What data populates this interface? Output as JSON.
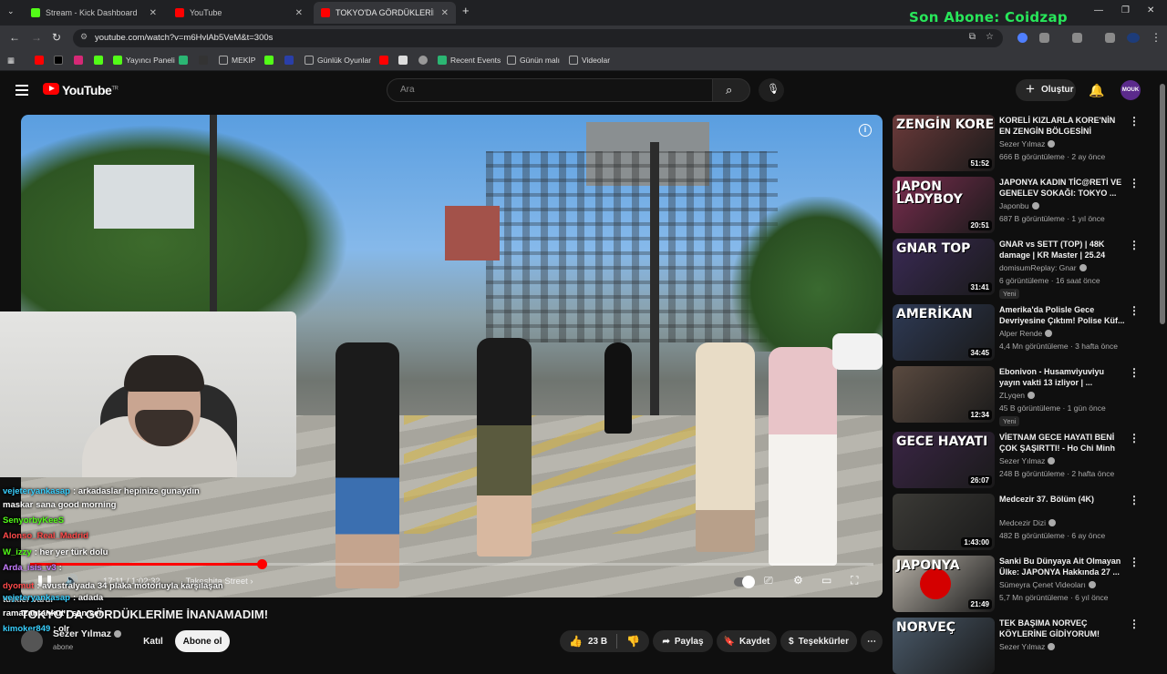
{
  "browser": {
    "tabs": [
      {
        "label": "Stream - Kick Dashboard",
        "color": "#53fc18"
      },
      {
        "label": "YouTube",
        "color": "#ff0000"
      },
      {
        "label": "TOKYO'DA GÖRDÜKLERİM...",
        "color": "#ff0000"
      }
    ],
    "new_tab": "+",
    "stream_overlay": "Son Abone: Coidzap",
    "url": "youtube.com/watch?v=m6HvlAb5VeM&t=300s",
    "bookmarks": [
      {
        "label": "Yayıncı Paneli",
        "color": "#53fc18"
      },
      {
        "label": "MEKİP",
        "color": "#888888"
      },
      {
        "label": "Günlük Oyunlar",
        "color": "#888888"
      },
      {
        "label": "Recent Events",
        "color": "#2bb673"
      },
      {
        "label": "Günün malı",
        "color": "#888888"
      },
      {
        "label": "Videolar",
        "color": "#888888"
      }
    ]
  },
  "header": {
    "brand": "YouTube",
    "brand_sup": "TR",
    "search_placeholder": "Ara",
    "create_label": "Oluştur",
    "avatar_text": "MOUK"
  },
  "player": {
    "time": "17:11 / 1:02:32",
    "chapter": "Takeshita Street",
    "progress": 0.275
  },
  "chat": [
    {
      "user": "vejeteryankasap",
      "msg": ": arkadaslar hepinize gunaydın",
      "color": "#39d0ff"
    },
    {
      "user": "maskar",
      "msg": "sana good morning",
      "color": "#ffffff"
    },
    {
      "user": "SenyorbyKeeS",
      "msg": "",
      "color": "#53fc18"
    },
    {
      "user": "Alonso_Real_Madrid",
      "msg": "",
      "color": "#ff4a4a"
    },
    {
      "user": "W_izzy",
      "msg": ": her yer türk dolu",
      "color": "#53fc18"
    },
    {
      "user": "Arda_isis_v3",
      "msg": ":",
      "color": "#c77dff"
    },
    {
      "user": "dyomut",
      "msg": ": avustralyada 34 plaka motorluyla karşılaşan türkler vardı",
      "color": "#ff4a4a"
    },
    {
      "user": "vejeteryankasap",
      "msg": ": adada",
      "color": "#39d0ff"
    },
    {
      "user": "ramazantankut",
      "msg": ": sen sen",
      "color": "#ffffff"
    },
    {
      "user": "kimoker849",
      "msg": ": olr",
      "color": "#39d0ff"
    }
  ],
  "video": {
    "title": "TOKYO'DA GÖRDÜKLERİME İNANAMADIM!",
    "channel": "Sezer Yılmaz",
    "subs": "abone",
    "join_label": "Katıl",
    "subscribe_label": "Abone ol",
    "likes": "23 B",
    "share_label": "Paylaş",
    "save_label": "Kaydet",
    "thanks_label": "Teşekkürler"
  },
  "recommendations": [
    {
      "thumb_text": "ZENGİN KORE",
      "thumb_color": "#6b3a3a",
      "duration": "51:52",
      "title": "KORELİ KIZLARLA KORE'NİN EN ZENGİN BÖLGESİNİ GEZDİM!",
      "channel": "Sezer Yılmaz",
      "meta": "666 B görüntüleme · 2 ay önce",
      "badge": ""
    },
    {
      "thumb_text": "JAPON LADYBOY",
      "thumb_color": "#7a2d4f",
      "duration": "20:51",
      "title": "JAPONYA KADIN TİC@RETİ VE GENELEV SOKAĞI: TOKYO ...",
      "channel": "Japonbu",
      "meta": "687 B görüntüleme · 1 yıl önce",
      "badge": ""
    },
    {
      "thumb_text": "GNAR TOP",
      "thumb_color": "#3a2a55",
      "duration": "31:41",
      "title": "GNAR vs SETT (TOP) | 48K damage | KR Master | 25.24",
      "channel": "domisumReplay: Gnar",
      "meta": "6 görüntüleme · 16 saat önce",
      "badge": "Yeni"
    },
    {
      "thumb_text": "AMERİKAN",
      "thumb_color": "#2e3a55",
      "duration": "34:45",
      "title": "Amerika'da Polisle Gece Devriyesine Çıktım! Polise Küf...",
      "channel": "Alper Rende",
      "meta": "4,4 Mn görüntüleme · 3 hafta önce",
      "badge": ""
    },
    {
      "thumb_text": "",
      "thumb_color": "#5a4a40",
      "duration": "12:34",
      "title": "Ebonivon - Husamviyuviyu yayın vakti 13 izliyor | ...",
      "channel": "ZLyqen",
      "meta": "45 B görüntüleme · 1 gün önce",
      "badge": "Yeni"
    },
    {
      "thumb_text": "GECE HAYATI",
      "thumb_color": "#3a2545",
      "duration": "26:07",
      "title": "VİETNAM GECE HAYATI BENİ ÇOK ŞAŞIRTTI! - Ho Chi Minh",
      "channel": "Sezer Yılmaz",
      "meta": "248 B görüntüleme · 2 hafta önce",
      "badge": ""
    },
    {
      "thumb_text": "",
      "thumb_color": "#3b3a36",
      "duration": "1:43:00",
      "title": "Medcezir 37. Bölüm (4K)",
      "channel": "Medcezir Dizi",
      "meta": "482 B görüntüleme · 6 ay önce",
      "badge": ""
    },
    {
      "thumb_text": "JAPONYA",
      "thumb_color": "#b8b2a8",
      "duration": "21:49",
      "title": "Sanki Bu Dünyaya Ait Olmayan Ülke: JAPONYA Hakkında 27 ...",
      "channel": "Sümeyra Çenet Videoları",
      "meta": "5,7 Mn görüntüleme · 6 yıl önce",
      "badge": ""
    },
    {
      "thumb_text": "NORVEÇ",
      "thumb_color": "#4a5a6a",
      "duration": "",
      "title": "TEK BAŞIMA NORVEÇ KÖYLERİNE GİDİYORUM!",
      "channel": "Sezer Yılmaz",
      "meta": "",
      "badge": ""
    }
  ]
}
